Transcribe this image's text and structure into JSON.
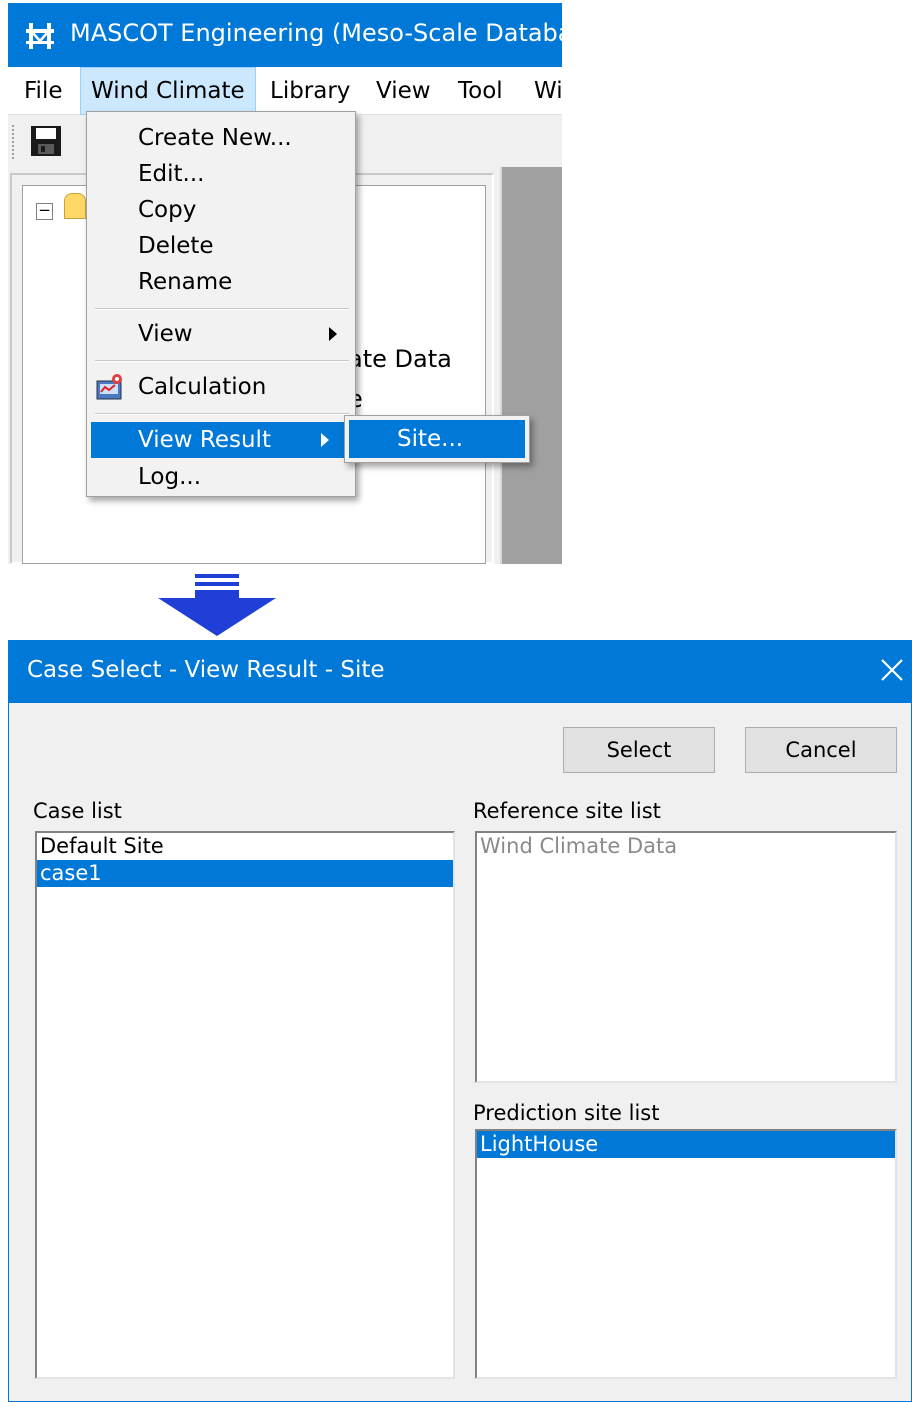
{
  "main_window": {
    "title": "MASCOT Engineering (Meso-Scale Database",
    "menu": [
      "File",
      "Wind Climate",
      "Library",
      "View",
      "Tool",
      "Wi"
    ],
    "background_fragments": [
      "ate Data",
      "e"
    ],
    "dropdown": {
      "items": [
        "Create New...",
        "Edit...",
        "Copy",
        "Delete",
        "Rename",
        "View",
        "Calculation",
        "View Result",
        "Log..."
      ]
    },
    "submenu": {
      "item": "Site..."
    }
  },
  "dialog": {
    "title": "Case Select - View Result - Site",
    "select_label": "Select",
    "cancel_label": "Cancel",
    "case_list": {
      "label": "Case list",
      "items": [
        "Default Site",
        "case1"
      ],
      "selected": "case1"
    },
    "reference_site_list": {
      "label": "Reference site list",
      "items": [
        "Wind Climate Data"
      ]
    },
    "prediction_site_list": {
      "label": "Prediction site list",
      "items": [
        "LightHouse"
      ],
      "selected": "LightHouse"
    }
  },
  "colors": {
    "accent": "#0078d7",
    "menu_hover": "#cce8ff",
    "dialog_bg": "#f0f0f0"
  },
  "icons": [
    "bridge-app-icon",
    "save-icon",
    "calculation-icon",
    "close-icon",
    "down-arrow-icon"
  ]
}
